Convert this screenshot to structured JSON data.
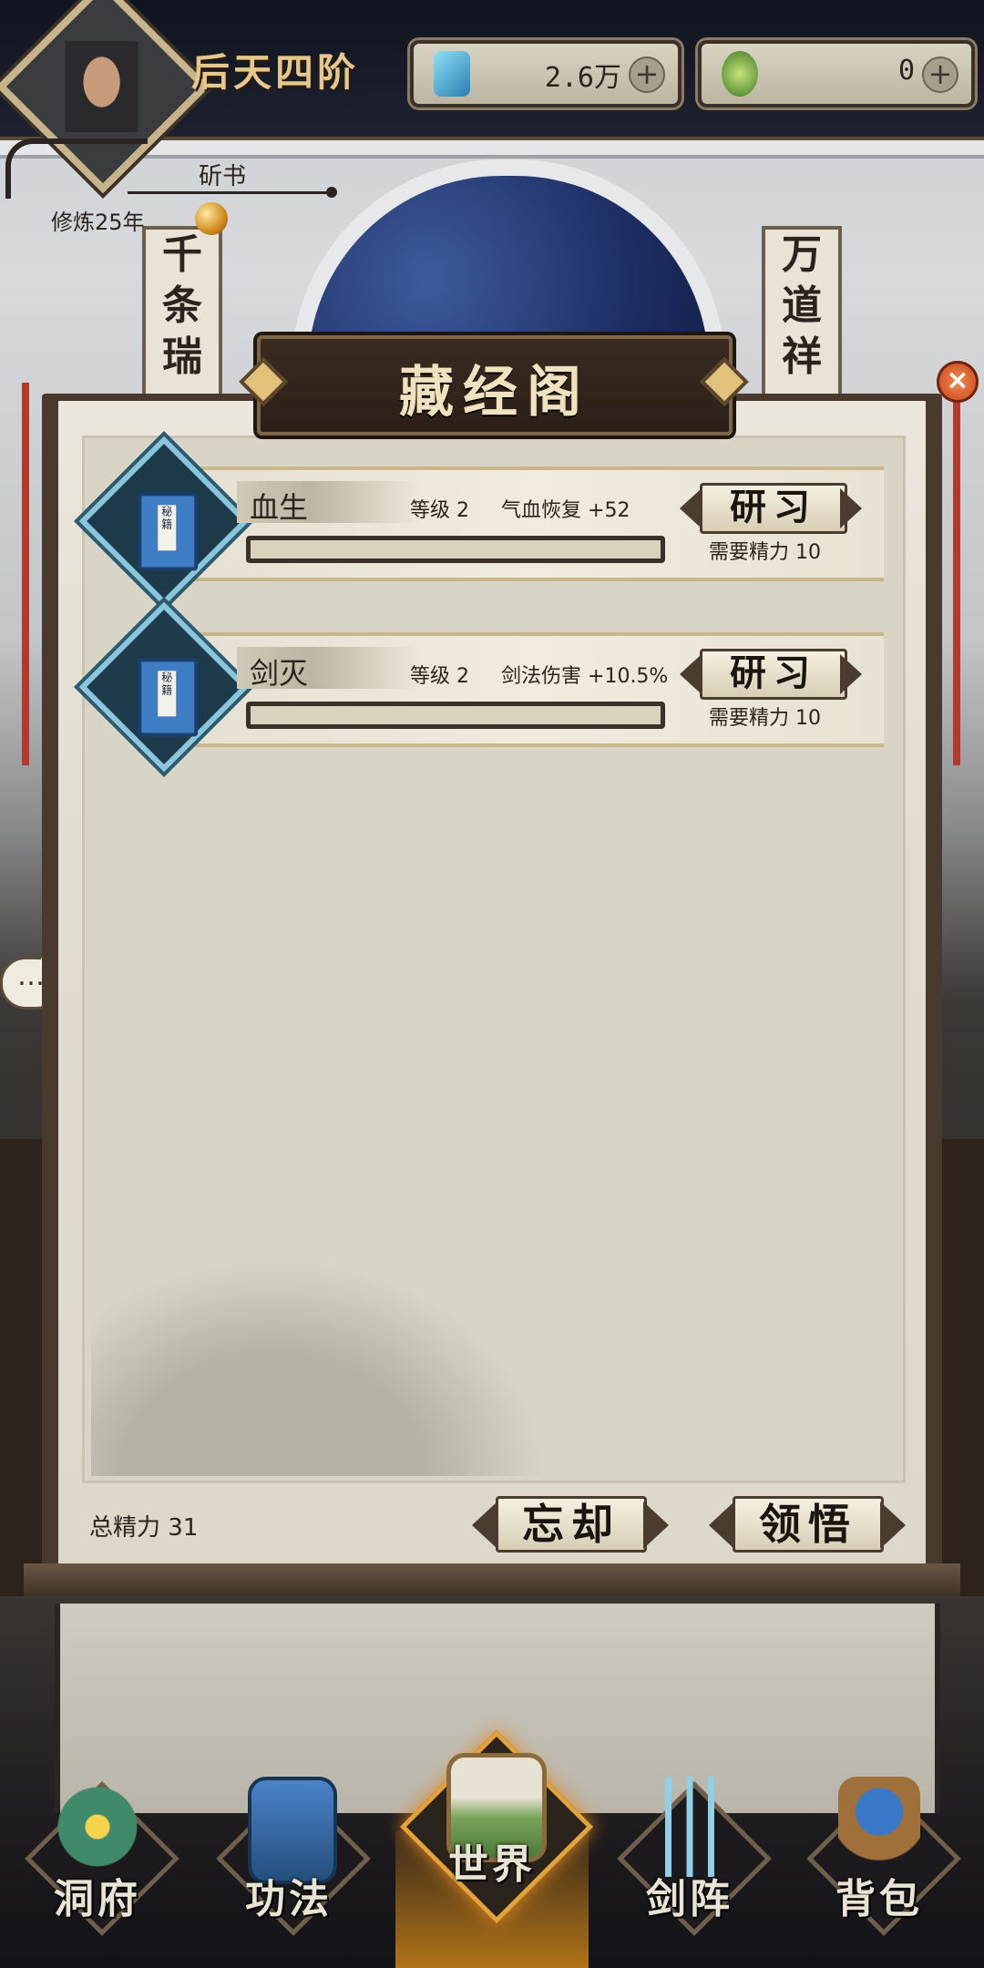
{
  "header": {
    "rank_title": "后天四阶",
    "currencies": [
      {
        "icon": "spirit-stone-icon",
        "value": "2.6万",
        "color": "#3aa0c8"
      },
      {
        "icon": "jade-coin-icon",
        "value": "0",
        "color": "#6aa83a"
      }
    ],
    "player_name": "斫书",
    "cultivation": "修炼25年"
  },
  "background": {
    "left_scroll": "千条瑞",
    "right_scroll": "万道祥"
  },
  "panel": {
    "title": "藏经阁",
    "skills": [
      {
        "name": "血生",
        "level_label": "等级",
        "level": "2",
        "effect_label": "气血恢复",
        "effect_value": "+52",
        "button": "研习",
        "cost_label": "需要精力",
        "cost_value": "10",
        "progress": 0.0,
        "book_label": "秘籍"
      },
      {
        "name": "剑灭",
        "level_label": "等级",
        "level": "2",
        "effect_label": "剑法伤害",
        "effect_value": "+10.5%",
        "button": "研习",
        "cost_label": "需要精力",
        "cost_value": "10",
        "progress": 0.0,
        "book_label": "秘籍"
      }
    ],
    "total_energy_label": "总精力",
    "total_energy_value": "31",
    "forget_button": "忘却",
    "comprehend_button": "领悟"
  },
  "nav": [
    {
      "label": "洞府",
      "icon": "cave-dwelling-icon",
      "active": false
    },
    {
      "label": "功法",
      "icon": "technique-book-icon",
      "active": false
    },
    {
      "label": "世界",
      "icon": "world-scroll-icon",
      "active": true
    },
    {
      "label": "剑阵",
      "icon": "sword-formation-icon",
      "active": false
    },
    {
      "label": "背包",
      "icon": "backpack-icon",
      "active": false
    }
  ],
  "colors": {
    "accent_gold": "#e6c98a",
    "panel_paper": "#e6e1d4",
    "wood_dark": "#4a3a2d",
    "active_nav": "#b07418"
  }
}
